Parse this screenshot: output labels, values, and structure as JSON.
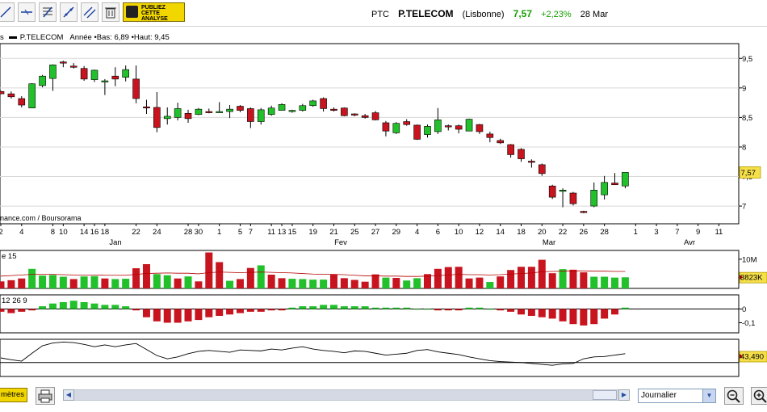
{
  "toolbar": {
    "tools": [
      "draw-line-icon",
      "horizontal-line-icon",
      "fibonacci-icon",
      "trend-channel-icon",
      "parallel-lines-icon",
      "trash-icon"
    ],
    "pub_lines": [
      "PUBLIEZ",
      "CETTE",
      "ANALYSE"
    ]
  },
  "quote": {
    "ticker": "PTC",
    "name": "P.TELECOM",
    "market": "(Lisbonne)",
    "last": "7,57",
    "change": "+2,23%",
    "date": "28 Mar"
  },
  "legend": {
    "prefix": "s",
    "series": "P.TELECOM",
    "range_text": "Année •Bas: 6,89 •Haut: 9,45"
  },
  "chart_data": [
    {
      "type": "candlestick",
      "ylim": [
        6.7,
        9.75
      ],
      "y_ticks": [
        "9,5",
        "9",
        "8,5",
        "8",
        "7,5",
        "7"
      ],
      "last_value_label": "7,57",
      "source_label": "nance.com / Boursorama",
      "x_tick_labels": [
        "2",
        "4",
        "8",
        "10",
        "14",
        "16",
        "18",
        "22",
        "24",
        "28",
        "30",
        "1",
        "5",
        "7",
        "11",
        "13",
        "15",
        "19",
        "21",
        "25",
        "27",
        "29",
        "4",
        "6",
        "10",
        "12",
        "14",
        "18",
        "20",
        "22",
        "26",
        "28",
        "1",
        "3",
        "7",
        "9",
        "11"
      ],
      "month_labels": [
        "Jan",
        "Fev",
        "Mar",
        "Avr"
      ],
      "candles": [
        [
          8.94,
          8.95,
          8.93,
          8.9
        ],
        [
          8.9,
          8.94,
          8.82,
          8.85
        ],
        [
          8.82,
          8.86,
          8.67,
          8.71
        ],
        [
          8.66,
          9.08,
          8.66,
          9.07
        ],
        [
          9.04,
          9.22,
          9.01,
          9.2
        ],
        [
          9.16,
          9.4,
          8.95,
          9.39
        ],
        [
          9.44,
          9.46,
          9.35,
          9.42
        ],
        [
          9.37,
          9.42,
          9.33,
          9.36
        ],
        [
          9.33,
          9.37,
          9.12,
          9.15
        ],
        [
          9.14,
          9.31,
          9.1,
          9.3
        ],
        [
          9.1,
          9.15,
          8.88,
          9.12
        ],
        [
          9.2,
          9.35,
          9.03,
          9.15
        ],
        [
          9.18,
          9.38,
          9.11,
          9.31
        ],
        [
          9.15,
          9.38,
          8.74,
          8.82
        ],
        [
          8.68,
          8.8,
          8.56,
          8.67
        ],
        [
          8.67,
          8.93,
          8.25,
          8.33
        ],
        [
          8.48,
          8.67,
          8.38,
          8.52
        ],
        [
          8.5,
          8.75,
          8.45,
          8.65
        ],
        [
          8.57,
          8.63,
          8.41,
          8.48
        ],
        [
          8.55,
          8.66,
          8.54,
          8.64
        ],
        [
          8.6,
          8.65,
          8.57,
          8.59
        ],
        [
          8.59,
          8.76,
          8.58,
          8.6
        ],
        [
          8.6,
          8.71,
          8.49,
          8.64
        ],
        [
          8.69,
          8.71,
          8.59,
          8.62
        ],
        [
          8.65,
          8.67,
          8.32,
          8.43
        ],
        [
          8.43,
          8.66,
          8.38,
          8.63
        ],
        [
          8.55,
          8.7,
          8.53,
          8.66
        ],
        [
          8.62,
          8.74,
          8.62,
          8.72
        ],
        [
          8.6,
          8.63,
          8.58,
          8.62
        ],
        [
          8.62,
          8.73,
          8.6,
          8.7
        ],
        [
          8.7,
          8.8,
          8.68,
          8.78
        ],
        [
          8.82,
          8.84,
          8.6,
          8.65
        ],
        [
          8.64,
          8.67,
          8.6,
          8.62
        ],
        [
          8.66,
          8.67,
          8.52,
          8.53
        ],
        [
          8.56,
          8.57,
          8.52,
          8.54
        ],
        [
          8.53,
          8.56,
          8.48,
          8.5
        ],
        [
          8.58,
          8.61,
          8.45,
          8.46
        ],
        [
          8.41,
          8.44,
          8.18,
          8.27
        ],
        [
          8.24,
          8.42,
          8.22,
          8.4
        ],
        [
          8.43,
          8.47,
          8.36,
          8.38
        ],
        [
          8.37,
          8.38,
          8.12,
          8.13
        ],
        [
          8.21,
          8.38,
          8.16,
          8.35
        ],
        [
          8.26,
          8.66,
          8.22,
          8.46
        ],
        [
          8.36,
          8.38,
          8.28,
          8.34
        ],
        [
          8.36,
          8.38,
          8.23,
          8.3
        ],
        [
          8.27,
          8.48,
          8.27,
          8.47
        ],
        [
          8.38,
          8.39,
          8.22,
          8.26
        ],
        [
          8.22,
          8.26,
          8.08,
          8.16
        ],
        [
          8.11,
          8.14,
          8.05,
          8.07
        ],
        [
          8.04,
          8.05,
          7.82,
          7.87
        ],
        [
          7.96,
          7.98,
          7.75,
          7.8
        ],
        [
          7.76,
          7.79,
          7.65,
          7.74
        ],
        [
          7.7,
          7.72,
          7.51,
          7.55
        ],
        [
          7.34,
          7.36,
          7.12,
          7.15
        ],
        [
          7.27,
          7.3,
          6.98,
          7.27
        ],
        [
          7.22,
          7.24,
          7.01,
          7.04
        ],
        [
          6.91,
          6.92,
          6.88,
          6.89
        ],
        [
          7.0,
          7.4,
          6.98,
          7.27
        ],
        [
          7.19,
          7.51,
          7.11,
          7.4
        ],
        [
          7.39,
          7.56,
          7.36,
          7.36
        ],
        [
          7.34,
          7.56,
          7.3,
          7.57
        ]
      ]
    },
    {
      "type": "bar",
      "label": "e 15",
      "y_ticks": [
        "10M"
      ],
      "last_value_label": "3823K",
      "values": [
        2.4,
        2.8,
        3.4,
        6.7,
        4.4,
        4.6,
        4.0,
        3.2,
        4.1,
        4.2,
        3.4,
        3.2,
        3.3,
        6.9,
        8.3,
        4.9,
        4.5,
        3.4,
        4.1,
        2.4,
        12.3,
        9.0,
        2.6,
        3.2,
        7.0,
        7.9,
        4.7,
        3.5,
        3.3,
        3.2,
        3.0,
        3.0,
        4.8,
        3.5,
        2.9,
        2.3,
        4.8,
        3.7,
        3.6,
        2.7,
        3.5,
        4.9,
        6.7,
        7.3,
        7.4,
        3.4,
        3.7,
        2.2,
        4.1,
        6.3,
        7.4,
        7.4,
        9.8,
        5.2,
        6.6,
        6.4,
        5.5,
        4.0,
        4.0,
        3.7,
        3.8
      ],
      "colors": [
        "r",
        "r",
        "r",
        "g",
        "g",
        "g",
        "g",
        "r",
        "g",
        "g",
        "r",
        "g",
        "g",
        "r",
        "r",
        "g",
        "g",
        "r",
        "g",
        "r",
        "r",
        "r",
        "g",
        "r",
        "r",
        "g",
        "r",
        "r",
        "g",
        "g",
        "g",
        "g",
        "r",
        "r",
        "r",
        "r",
        "r",
        "g",
        "r",
        "g",
        "g",
        "r",
        "r",
        "r",
        "r",
        "r",
        "r",
        "g",
        "r",
        "r",
        "r",
        "r",
        "r",
        "r",
        "g",
        "r",
        "r",
        "g",
        "g",
        "g",
        "g"
      ],
      "ma_line": [
        4.2,
        4.4,
        4.6,
        4.8,
        4.8,
        4.8,
        4.7,
        4.6,
        4.6,
        4.6,
        4.5,
        4.5,
        4.5,
        4.8,
        5.1,
        5.2,
        5.3,
        5.2,
        5.2,
        5.0,
        5.4,
        5.6,
        5.5,
        5.4,
        5.5,
        5.6,
        5.5,
        5.4,
        5.3,
        5.1,
        4.9,
        4.8,
        4.8,
        4.7,
        4.5,
        4.3,
        4.3,
        4.2,
        4.2,
        4.1,
        4.1,
        4.2,
        4.4,
        4.6,
        4.8,
        4.7,
        4.7,
        4.6,
        4.7,
        4.9,
        5.1,
        5.3,
        5.7,
        5.8,
        5.9,
        6.0,
        6.0,
        5.9,
        5.9,
        5.8,
        5.8
      ]
    },
    {
      "type": "bar",
      "label": "12 26 9",
      "y_ticks": [
        "0",
        "-0,1"
      ],
      "values": [
        -0.02,
        -0.03,
        -0.02,
        -0.01,
        0.02,
        0.04,
        0.05,
        0.06,
        0.05,
        0.04,
        0.03,
        0.03,
        0.02,
        -0.01,
        -0.06,
        -0.09,
        -0.1,
        -0.1,
        -0.09,
        -0.08,
        -0.06,
        -0.05,
        -0.04,
        -0.03,
        -0.02,
        -0.02,
        -0.01,
        -0.01,
        0.01,
        0.02,
        0.02,
        0.03,
        0.03,
        0.02,
        0.02,
        0.02,
        0.01,
        0.01,
        0.01,
        0.01,
        0.0,
        0.0,
        -0.01,
        -0.01,
        -0.01,
        0.01,
        0.01,
        0.0,
        -0.01,
        -0.02,
        -0.04,
        -0.05,
        -0.06,
        -0.07,
        -0.09,
        -0.11,
        -0.12,
        -0.11,
        -0.07,
        -0.04,
        0.01
      ]
    },
    {
      "type": "line",
      "last_value_label": "43,490",
      "values": [
        40,
        36,
        33,
        50,
        66,
        72,
        74,
        73,
        69,
        64,
        68,
        64,
        68,
        71,
        58,
        45,
        38,
        42,
        49,
        54,
        56,
        54,
        52,
        57,
        56,
        55,
        59,
        57,
        61,
        64,
        59,
        56,
        54,
        51,
        55,
        54,
        50,
        46,
        48,
        50,
        56,
        58,
        53,
        50,
        47,
        42,
        38,
        34,
        32,
        31,
        30,
        28,
        26,
        24,
        27,
        28,
        38,
        42,
        43,
        46,
        49
      ]
    }
  ],
  "bottom": {
    "params_label": "mètres",
    "period": "Journalier"
  }
}
